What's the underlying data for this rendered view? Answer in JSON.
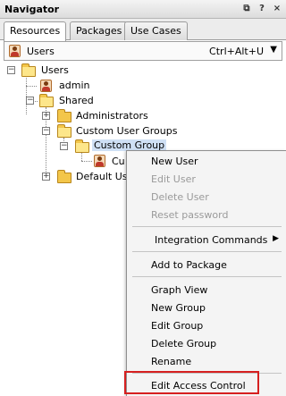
{
  "panel": {
    "title": "Navigator",
    "icons": [
      "restore-icon",
      "help-icon",
      "close-icon"
    ]
  },
  "tabs": [
    {
      "label": "Resources",
      "active": true
    },
    {
      "label": "Packages",
      "active": false
    },
    {
      "label": "Use Cases",
      "active": false
    }
  ],
  "toolbar": {
    "label": "Users",
    "shortcut": "Ctrl+Alt+U",
    "dropdown_glyph": "▼"
  },
  "tree": {
    "root": "Users",
    "admin": "admin",
    "shared": "Shared",
    "administrators": "Administrators",
    "custom_user_groups": "Custom User Groups",
    "custom_group": "Custom Group",
    "custom_group_child": "Cu",
    "default_users": "Default Us",
    "expand_glyph": "+",
    "collapse_glyph": "−"
  },
  "context_menu": {
    "new_user": "New User",
    "edit_user": "Edit User",
    "delete_user": "Delete User",
    "reset_password": "Reset password",
    "integration_commands": "Integration Commands",
    "add_to_package": "Add to Package",
    "graph_view": "Graph View",
    "new_group": "New Group",
    "edit_group": "Edit Group",
    "delete_group": "Delete Group",
    "rename": "Rename",
    "edit_access_control": "Edit Access Control",
    "submenu_glyph": "▶"
  },
  "colors": {
    "highlight_border": "#d62020",
    "selection": "#cfe0f5",
    "folder": "#f3c64a"
  }
}
